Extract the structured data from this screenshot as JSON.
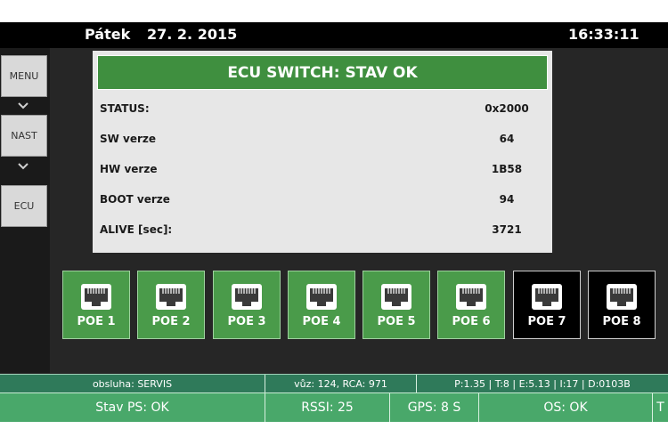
{
  "header": {
    "day": "Pátek",
    "date": "27. 2. 2015",
    "time": "16:33:11"
  },
  "sidebar": {
    "items": [
      {
        "label": "MENU"
      },
      {
        "label": "NAST"
      },
      {
        "label": "ECU"
      }
    ]
  },
  "panel": {
    "title": "ECU SWITCH:  STAV OK",
    "rows": [
      {
        "label": "STATUS:",
        "value": "0x2000"
      },
      {
        "label": "SW verze",
        "value": "64"
      },
      {
        "label": "HW verze",
        "value": "1B58"
      },
      {
        "label": "BOOT verze",
        "value": "94"
      },
      {
        "label": "ALIVE [sec]:",
        "value": "3721"
      }
    ]
  },
  "ports": [
    {
      "label": "POE 1",
      "active": true
    },
    {
      "label": "POE 2",
      "active": true
    },
    {
      "label": "POE 3",
      "active": true
    },
    {
      "label": "POE 4",
      "active": true
    },
    {
      "label": "POE 5",
      "active": true
    },
    {
      "label": "POE 6",
      "active": true
    },
    {
      "label": "POE 7",
      "active": false
    },
    {
      "label": "POE 8",
      "active": false
    }
  ],
  "status_top": {
    "operator": "obsluha: SERVIS",
    "vehicle": "vůz: 124, RCA: 971",
    "diagnostics": "P:1.35 | T:8 | E:5.13 | I:17 | D:0103B"
  },
  "status_bottom": {
    "ps": "Stav PS: OK",
    "rssi": "RSSI: 25",
    "gps": "GPS: 8 S",
    "os": "OS: OK",
    "extra": "T"
  },
  "colors": {
    "title_green": "#3f8f3f",
    "port_active": "#4a9b4a",
    "port_inactive": "#000000",
    "status_dark": "#2f7a5a",
    "status_light": "#49a86a"
  }
}
